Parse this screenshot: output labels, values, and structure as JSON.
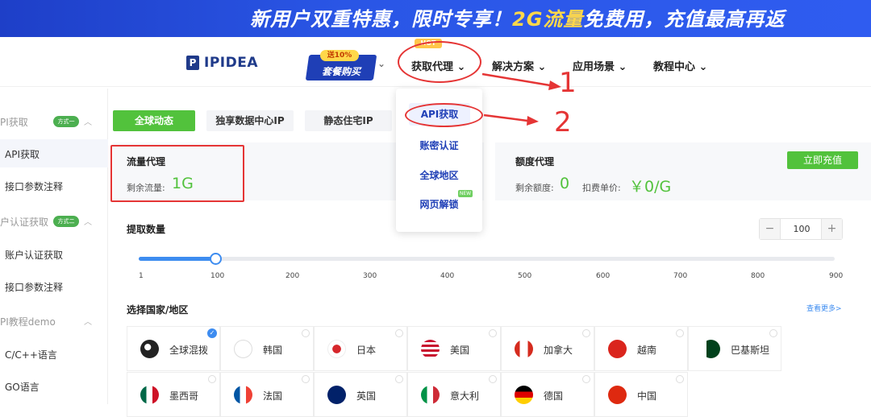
{
  "banner": {
    "text_a": "新用户双重特惠，限时专享！",
    "text_b": "2G流量",
    "text_c": "免费用，充值最高再返"
  },
  "nav": {
    "logo": "IPIDEA",
    "promo_tag": "送10%",
    "promo_label": "套餐购买",
    "hot_tag": "HOT",
    "items": [
      {
        "label": "获取代理 ⌄"
      },
      {
        "label": "解决方案 ⌄"
      },
      {
        "label": "应用场景 ⌄"
      },
      {
        "label": "教程中心 ⌄"
      }
    ]
  },
  "dropdown": {
    "items": [
      {
        "label": "API获取"
      },
      {
        "label": "账密认证"
      },
      {
        "label": "全球地区"
      },
      {
        "label": "网页解锁"
      }
    ],
    "new_tag": "NEW"
  },
  "sidebar": {
    "group1": "PI获取",
    "group1_badge": "方式一",
    "item_api": "API获取",
    "item_param1": "接口参数注释",
    "group2": "户认证获取",
    "group2_badge": "方式二",
    "item_account": "账户认证获取",
    "item_param2": "接口参数注释",
    "group3": "PI教程demo",
    "item_c": "C/C++语言",
    "item_go": "GO语言"
  },
  "tabs": [
    "全球动态",
    "独享数据中心IP",
    "静态住宅IP"
  ],
  "traffic": {
    "title": "流量代理",
    "label": "剩余流量:",
    "value": "1G"
  },
  "quota": {
    "title": "额度代理",
    "label": "剩余额度:",
    "value": "0",
    "price_label": "扣费单价:",
    "price_value": "￥0/G",
    "recharge": "立即充值"
  },
  "extract": {
    "title": "提取数量",
    "value": "100",
    "minus": "−",
    "plus": "+",
    "slider_fraction": 0.11,
    "ticks": [
      "1",
      "100",
      "200",
      "300",
      "400",
      "500",
      "600",
      "700",
      "800",
      "900"
    ]
  },
  "region": {
    "title": "选择国家/地区",
    "see_more": "查看更多>"
  },
  "countries": [
    {
      "name": "全球混拨",
      "selected": true,
      "flag": "globe-icon"
    },
    {
      "name": "韩国",
      "flag": "flag-korea-icon"
    },
    {
      "name": "日本",
      "flag": "flag-japan-icon"
    },
    {
      "name": "美国",
      "flag": "flag-usa-icon"
    },
    {
      "name": "加拿大",
      "flag": "flag-canada-icon"
    },
    {
      "name": "越南",
      "flag": "flag-vietnam-icon"
    },
    {
      "name": "巴基斯坦",
      "flag": "flag-pakistan-icon"
    },
    {
      "name": "墨西哥",
      "flag": "flag-mexico-icon"
    },
    {
      "name": "法国",
      "flag": "flag-france-icon"
    },
    {
      "name": "英国",
      "flag": "flag-uk-icon"
    },
    {
      "name": "意大利",
      "flag": "flag-italy-icon"
    },
    {
      "name": "德国",
      "flag": "flag-germany-icon"
    },
    {
      "name": "中国",
      "flag": "flag-china-icon"
    }
  ],
  "annotations": {
    "one": "1",
    "two": "2"
  },
  "colors": {
    "accent_green": "#52c23c",
    "brand_blue": "#1f3fb6",
    "annotation_red": "#e53535"
  }
}
